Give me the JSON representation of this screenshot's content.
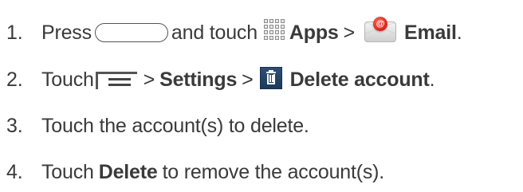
{
  "steps": [
    {
      "number": "1.",
      "press": "Press",
      "and_touch": "and touch",
      "apps": "Apps",
      "sep": ">",
      "email": "Email",
      "period": "."
    },
    {
      "number": "2.",
      "touch": "Touch",
      "sep1": ">",
      "settings": "Settings",
      "sep2": ">",
      "delete_account": "Delete account",
      "period": "."
    },
    {
      "number": "3.",
      "text": "Touch the account(s) to delete."
    },
    {
      "number": "4.",
      "touch": "Touch",
      "delete": "Delete",
      "rest": "to remove the account(s)."
    }
  ],
  "icons": {
    "home_key": "home-key-icon",
    "apps": "apps-grid-icon",
    "email": "email-app-icon",
    "menu": "menu-key-icon",
    "delete": "trash-icon"
  },
  "email_badge": "@",
  "colors": {
    "text": "#3a3a3a",
    "email_badge": "#d8211b",
    "trash_icon_bg": "#1c3a5b"
  }
}
